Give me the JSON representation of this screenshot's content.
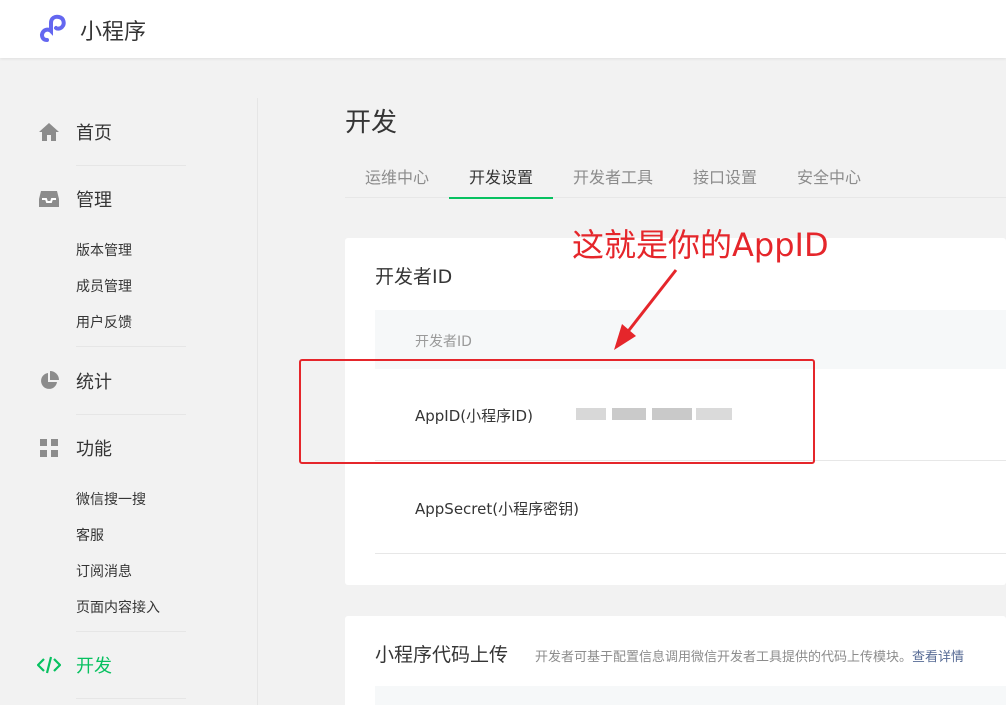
{
  "header": {
    "app_name": "小程序"
  },
  "sidebar": {
    "home": "首页",
    "manage": "管理",
    "manage_items": [
      "版本管理",
      "成员管理",
      "用户反馈"
    ],
    "stats": "统计",
    "features": "功能",
    "feature_items": [
      "微信搜一搜",
      "客服",
      "订阅消息",
      "页面内容接入"
    ],
    "develop": "开发"
  },
  "main": {
    "title": "开发",
    "tabs": [
      "运维中心",
      "开发设置",
      "开发者工具",
      "接口设置",
      "安全中心"
    ],
    "active_tab": "开发设置",
    "dev_id_card": {
      "title": "开发者ID",
      "column_header": "开发者ID",
      "appid_label": "AppID(小程序ID)",
      "appsecret_label": "AppSecret(小程序密钥)"
    },
    "upload_card": {
      "title": "小程序代码上传",
      "description": "开发者可基于配置信息调用微信开发者工具提供的代码上传模块。",
      "link": "查看详情"
    }
  },
  "annotation": {
    "text": "这就是你的AppID"
  },
  "colors": {
    "accent": "#07c160",
    "annotation": "#e5262b",
    "link": "#576b95"
  }
}
